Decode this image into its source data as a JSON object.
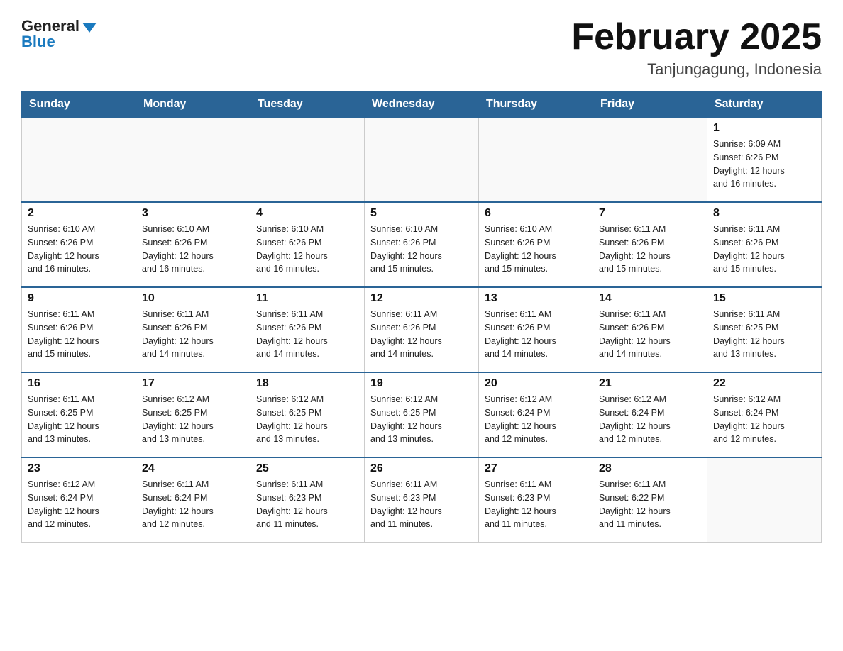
{
  "logo": {
    "text_general": "General",
    "text_blue": "Blue"
  },
  "title": "February 2025",
  "subtitle": "Tanjungagung, Indonesia",
  "weekdays": [
    "Sunday",
    "Monday",
    "Tuesday",
    "Wednesday",
    "Thursday",
    "Friday",
    "Saturday"
  ],
  "weeks": [
    [
      {
        "day": "",
        "info": ""
      },
      {
        "day": "",
        "info": ""
      },
      {
        "day": "",
        "info": ""
      },
      {
        "day": "",
        "info": ""
      },
      {
        "day": "",
        "info": ""
      },
      {
        "day": "",
        "info": ""
      },
      {
        "day": "1",
        "info": "Sunrise: 6:09 AM\nSunset: 6:26 PM\nDaylight: 12 hours\nand 16 minutes."
      }
    ],
    [
      {
        "day": "2",
        "info": "Sunrise: 6:10 AM\nSunset: 6:26 PM\nDaylight: 12 hours\nand 16 minutes."
      },
      {
        "day": "3",
        "info": "Sunrise: 6:10 AM\nSunset: 6:26 PM\nDaylight: 12 hours\nand 16 minutes."
      },
      {
        "day": "4",
        "info": "Sunrise: 6:10 AM\nSunset: 6:26 PM\nDaylight: 12 hours\nand 16 minutes."
      },
      {
        "day": "5",
        "info": "Sunrise: 6:10 AM\nSunset: 6:26 PM\nDaylight: 12 hours\nand 15 minutes."
      },
      {
        "day": "6",
        "info": "Sunrise: 6:10 AM\nSunset: 6:26 PM\nDaylight: 12 hours\nand 15 minutes."
      },
      {
        "day": "7",
        "info": "Sunrise: 6:11 AM\nSunset: 6:26 PM\nDaylight: 12 hours\nand 15 minutes."
      },
      {
        "day": "8",
        "info": "Sunrise: 6:11 AM\nSunset: 6:26 PM\nDaylight: 12 hours\nand 15 minutes."
      }
    ],
    [
      {
        "day": "9",
        "info": "Sunrise: 6:11 AM\nSunset: 6:26 PM\nDaylight: 12 hours\nand 15 minutes."
      },
      {
        "day": "10",
        "info": "Sunrise: 6:11 AM\nSunset: 6:26 PM\nDaylight: 12 hours\nand 14 minutes."
      },
      {
        "day": "11",
        "info": "Sunrise: 6:11 AM\nSunset: 6:26 PM\nDaylight: 12 hours\nand 14 minutes."
      },
      {
        "day": "12",
        "info": "Sunrise: 6:11 AM\nSunset: 6:26 PM\nDaylight: 12 hours\nand 14 minutes."
      },
      {
        "day": "13",
        "info": "Sunrise: 6:11 AM\nSunset: 6:26 PM\nDaylight: 12 hours\nand 14 minutes."
      },
      {
        "day": "14",
        "info": "Sunrise: 6:11 AM\nSunset: 6:26 PM\nDaylight: 12 hours\nand 14 minutes."
      },
      {
        "day": "15",
        "info": "Sunrise: 6:11 AM\nSunset: 6:25 PM\nDaylight: 12 hours\nand 13 minutes."
      }
    ],
    [
      {
        "day": "16",
        "info": "Sunrise: 6:11 AM\nSunset: 6:25 PM\nDaylight: 12 hours\nand 13 minutes."
      },
      {
        "day": "17",
        "info": "Sunrise: 6:12 AM\nSunset: 6:25 PM\nDaylight: 12 hours\nand 13 minutes."
      },
      {
        "day": "18",
        "info": "Sunrise: 6:12 AM\nSunset: 6:25 PM\nDaylight: 12 hours\nand 13 minutes."
      },
      {
        "day": "19",
        "info": "Sunrise: 6:12 AM\nSunset: 6:25 PM\nDaylight: 12 hours\nand 13 minutes."
      },
      {
        "day": "20",
        "info": "Sunrise: 6:12 AM\nSunset: 6:24 PM\nDaylight: 12 hours\nand 12 minutes."
      },
      {
        "day": "21",
        "info": "Sunrise: 6:12 AM\nSunset: 6:24 PM\nDaylight: 12 hours\nand 12 minutes."
      },
      {
        "day": "22",
        "info": "Sunrise: 6:12 AM\nSunset: 6:24 PM\nDaylight: 12 hours\nand 12 minutes."
      }
    ],
    [
      {
        "day": "23",
        "info": "Sunrise: 6:12 AM\nSunset: 6:24 PM\nDaylight: 12 hours\nand 12 minutes."
      },
      {
        "day": "24",
        "info": "Sunrise: 6:11 AM\nSunset: 6:24 PM\nDaylight: 12 hours\nand 12 minutes."
      },
      {
        "day": "25",
        "info": "Sunrise: 6:11 AM\nSunset: 6:23 PM\nDaylight: 12 hours\nand 11 minutes."
      },
      {
        "day": "26",
        "info": "Sunrise: 6:11 AM\nSunset: 6:23 PM\nDaylight: 12 hours\nand 11 minutes."
      },
      {
        "day": "27",
        "info": "Sunrise: 6:11 AM\nSunset: 6:23 PM\nDaylight: 12 hours\nand 11 minutes."
      },
      {
        "day": "28",
        "info": "Sunrise: 6:11 AM\nSunset: 6:22 PM\nDaylight: 12 hours\nand 11 minutes."
      },
      {
        "day": "",
        "info": ""
      }
    ]
  ]
}
